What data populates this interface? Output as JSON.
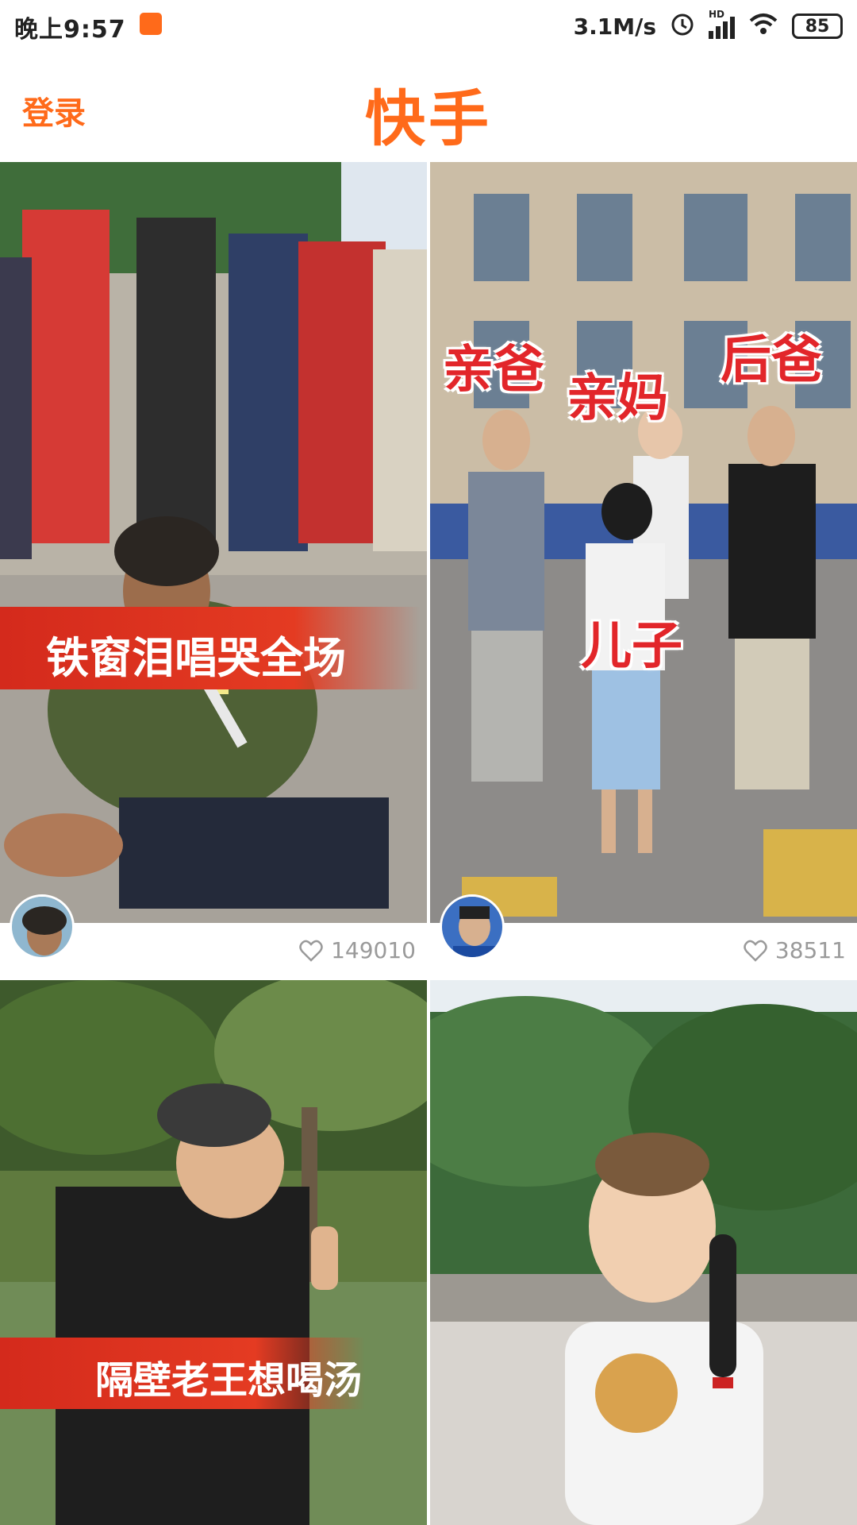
{
  "status_bar": {
    "time": "晚上9:57",
    "network_speed": "3.1M/s",
    "network_label": "HD",
    "battery": "85"
  },
  "header": {
    "login_label": "登录",
    "title": "快手"
  },
  "cards": [
    {
      "overlay": "铁窗泪唱哭全场",
      "likes": "149010"
    },
    {
      "labels": {
        "father": "亲爸",
        "mother": "亲妈",
        "stepfather": "后爸",
        "son": "儿子"
      },
      "likes": "38511"
    },
    {
      "overlay": "隔壁老王想喝汤"
    },
    {}
  ],
  "colors": {
    "brand": "#ff6a1a",
    "label_red": "#e2262a",
    "likes_gray": "#9a9a9a"
  }
}
